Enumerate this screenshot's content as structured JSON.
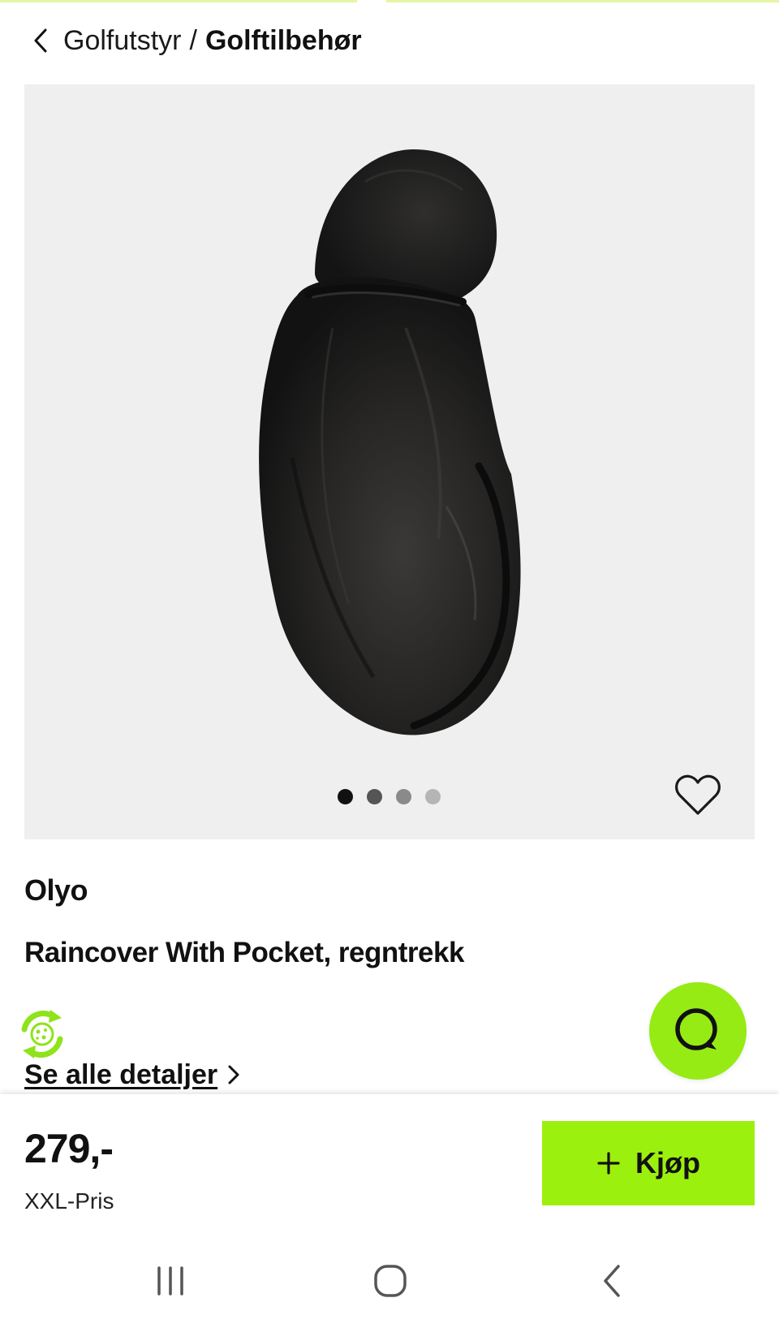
{
  "breadcrumb": {
    "parent": "Golfutstyr",
    "separator": "/",
    "current": "Golftilbehør"
  },
  "gallery": {
    "image_subject": "black golf bag rain cover",
    "dots": [
      {
        "state": "active",
        "color": "#111111"
      },
      {
        "state": "inactive",
        "color": "#555555"
      },
      {
        "state": "inactive",
        "color": "#8a8a8a"
      },
      {
        "state": "inactive",
        "color": "#b5b5b5"
      }
    ],
    "favorite_icon": "heart-outline-icon"
  },
  "product": {
    "brand": "Olyo",
    "name": "Raincover With Pocket, regntrekk",
    "details_link": "alle detaljer",
    "eco_badge_icon": "recycle-badge-icon"
  },
  "chat": {
    "icon": "chat-bubble-icon",
    "color": "#96eb14"
  },
  "purchase": {
    "price": "279,-",
    "price_label": "XXL-Pris",
    "buy_label": "Kjøp",
    "buy_color": "#9cf00e"
  },
  "system_nav": {
    "recents_icon": "recent-apps-icon",
    "home_icon": "home-icon",
    "back_icon": "back-icon"
  }
}
